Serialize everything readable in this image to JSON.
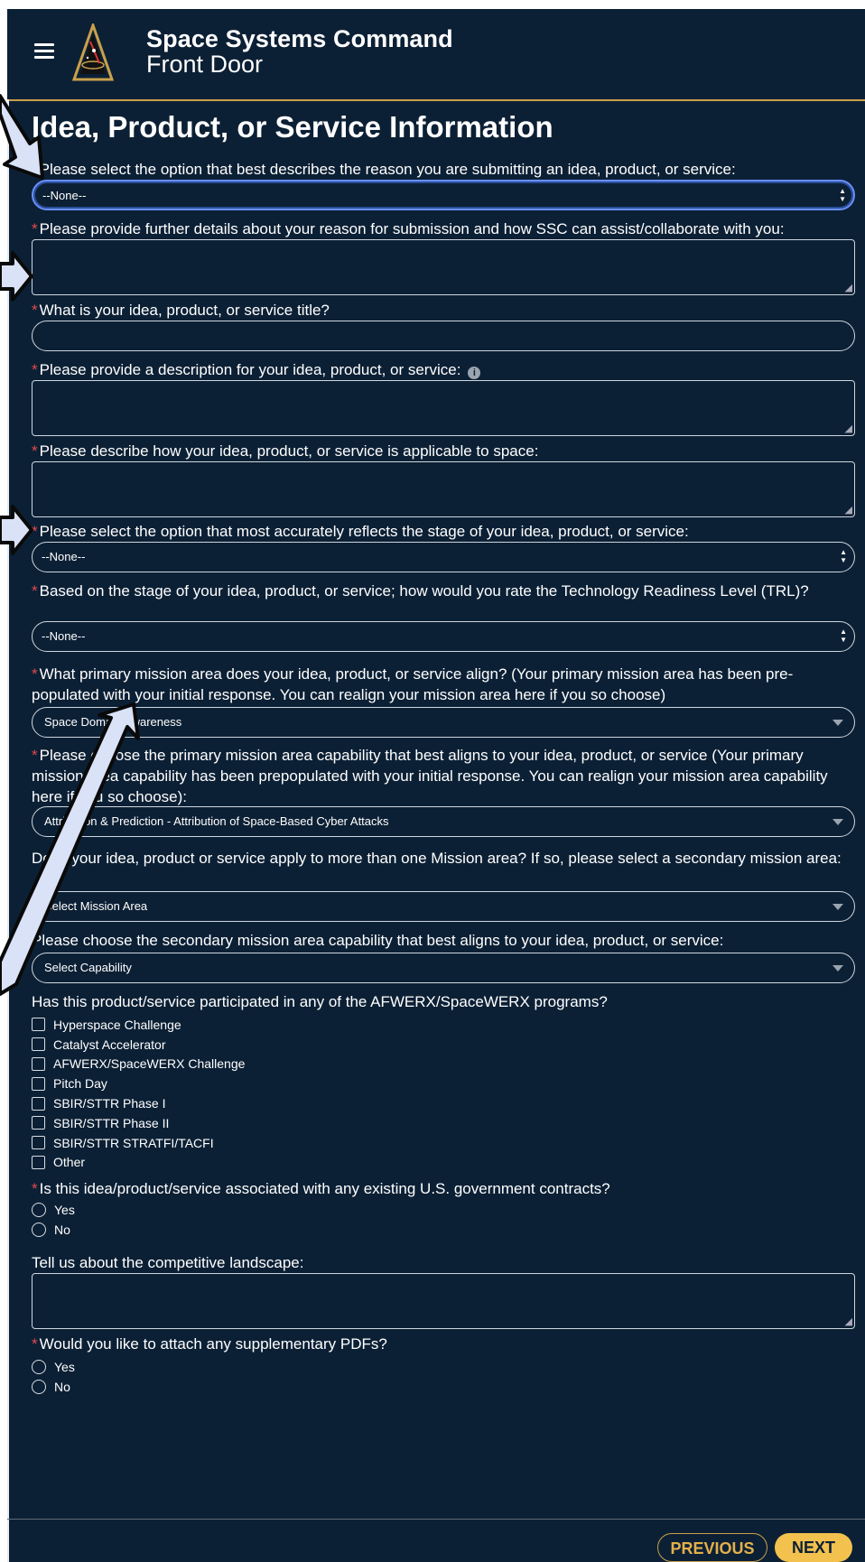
{
  "header": {
    "title": "Space Systems Command",
    "subtitle": "Front Door",
    "menu_icon": "hamburger-icon",
    "logo": "ssc-delta-logo"
  },
  "page": {
    "title": "Idea, Product, or Service Information"
  },
  "fields": {
    "reason_select": {
      "label": "Please select the option that best describes the reason you are submitting an idea, product, or service:",
      "value": "--None--"
    },
    "further_details": {
      "label": "Please provide further details about your reason for submission and how SSC can assist/collaborate with you:",
      "value": ""
    },
    "title": {
      "label": "What is your idea, product, or service title?",
      "value": ""
    },
    "description": {
      "label": "Please provide a description for your idea, product, or service:",
      "value": ""
    },
    "space_applicability": {
      "label": "Please describe how your idea, product, or service is applicable to space:",
      "value": ""
    },
    "stage": {
      "label": "Please select the option that most accurately reflects the stage of your idea, product, or service:",
      "value": "--None--"
    },
    "trl": {
      "label": "Based on the stage of your idea, product, or service; how would you rate the Technology Readiness Level (TRL)?",
      "value": "--None--"
    },
    "primary_mission": {
      "label": "What primary mission area does your idea, product, or service align? (Your primary mission area has been pre-populated with your initial response. You can realign your mission area here if you so choose)",
      "value": "Space Domain Awareness"
    },
    "primary_capability": {
      "label": "Please choose the primary mission area capability that best aligns to your idea, product, or service (Your primary mission area capability has been prepopulated with your initial response. You can realign your mission area capability here if you so choose):",
      "value": "Attribution & Prediction - Attribution of Space-Based Cyber Attacks"
    },
    "secondary_mission": {
      "label": "Does your idea, product or service apply to more than one Mission area? If so, please select a secondary mission area:",
      "value": "Select Mission Area"
    },
    "secondary_capability": {
      "label": "Please choose the secondary mission area capability that best aligns to your idea, product, or service:",
      "value": "Select Capability"
    },
    "programs": {
      "label": "Has this product/service participated in any of the AFWERX/SpaceWERX programs?",
      "options": [
        "Hyperspace Challenge",
        "Catalyst Accelerator",
        "AFWERX/SpaceWERX Challenge",
        "Pitch Day",
        "SBIR/STTR Phase I",
        "SBIR/STTR Phase II",
        "SBIR/STTR STRATFI/TACFI",
        "Other"
      ]
    },
    "gov_contracts": {
      "label": "Is this idea/product/service associated with any existing U.S. government contracts?",
      "options": [
        "Yes",
        "No"
      ]
    },
    "competitive": {
      "label": "Tell us about the competitive landscape:",
      "value": ""
    },
    "pdfs": {
      "label": "Would you like to attach any supplementary PDFs?",
      "options": [
        "Yes",
        "No"
      ]
    }
  },
  "required_mark": "*",
  "buttons": {
    "previous": "PREVIOUS",
    "next": "NEXT"
  },
  "colors": {
    "background": "#0c2035",
    "accent": "#f2c14e",
    "required": "#e5484d",
    "focus": "#6a90ff",
    "arrow": "#d9e2f7"
  }
}
